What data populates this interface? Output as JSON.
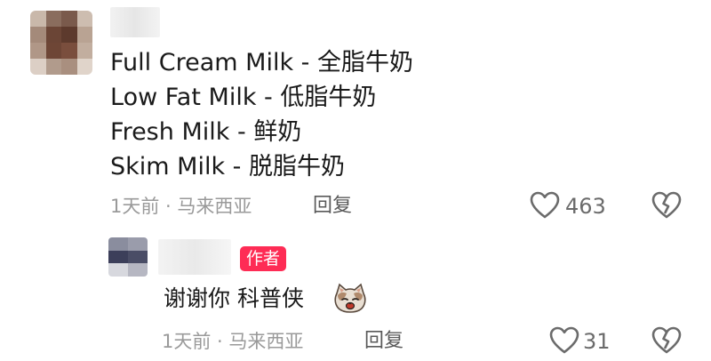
{
  "comment": {
    "lines": [
      "Full Cream Milk - 全脂牛奶",
      "Low Fat Milk - 低脂牛奶",
      "Fresh Milk - 鲜奶",
      "Skim Milk - 脱脂牛奶"
    ],
    "meta": "1天前 · 马来西亚",
    "reply_label": "回复",
    "like_count": "463"
  },
  "reply": {
    "author_badge": "作者",
    "text": "谢谢你 科普侠",
    "meta": "1天前 · 马来西亚",
    "reply_label": "回复",
    "like_count": "31",
    "emoji_icon": "cat-face-emoji"
  },
  "colors": {
    "badge_bg": "#fe2c55",
    "meta_text": "#9a9a9a",
    "primary_text": "#1a1a1a"
  }
}
